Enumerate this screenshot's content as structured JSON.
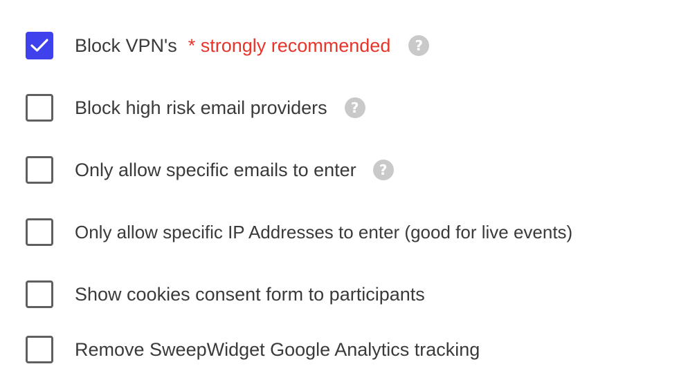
{
  "options": [
    {
      "label": "Block VPN's",
      "checked": true,
      "note": "* strongly recommended",
      "help_icon": "help-icon",
      "help_text": "?"
    },
    {
      "label": "Block high risk email providers",
      "checked": false,
      "help_icon": "help-icon",
      "help_text": "?"
    },
    {
      "label": "Only allow specific emails to enter",
      "checked": false,
      "help_icon": "help-icon",
      "help_text": "?"
    },
    {
      "label": "Only allow specific IP Addresses to enter (good for live events)",
      "checked": false
    },
    {
      "label": "Show cookies consent form to participants",
      "checked": false
    },
    {
      "label": "Remove SweepWidget Google Analytics tracking",
      "checked": false
    }
  ],
  "colors": {
    "accent": "#3f41ec",
    "note": "#e8352a",
    "help_icon_bg": "#c9c9c9",
    "checkbox_border": "#5f5f5f",
    "text": "#3a3a3a"
  }
}
